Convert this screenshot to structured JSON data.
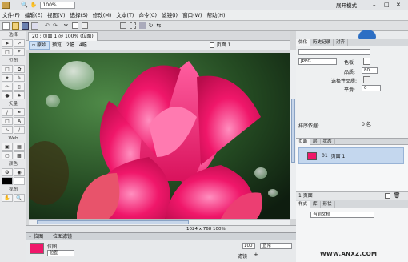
{
  "titlebar": {
    "zoom": "100%",
    "workspace": "展开模式"
  },
  "menu": [
    "文件(F)",
    "编辑(E)",
    "视图(V)",
    "选择(S)",
    "修改(M)",
    "文本(T)",
    "命令(C)",
    "滤镜(I)",
    "窗口(W)",
    "帮助(H)"
  ],
  "tools": {
    "select": "选择",
    "bitmap": "位图",
    "vector": "矢量",
    "web": "Web",
    "colors": "颜色",
    "view": "视图"
  },
  "document": {
    "tab": "20 : 页面 1 @ 100% (位图)",
    "views": [
      "原始",
      "预览",
      "2幅",
      "4幅"
    ],
    "page_label": "页面 1",
    "status": "1024 x 768   100%"
  },
  "properties": {
    "header_left": "位图",
    "header_right": "位图滤镜",
    "type": "位图",
    "name": "位图",
    "opacity": "100",
    "blend": "正常",
    "filter_label": "滤镜"
  },
  "right_panel": {
    "tabs": [
      "优化",
      "历史记录",
      "对齐"
    ],
    "format": "JPEG",
    "matte_label": "色板",
    "quality_label": "品质:",
    "quality": "80",
    "selective_label": "选择性品质:",
    "smoothing_label": "平滑:",
    "smoothing": "0",
    "sort_label": "排序依据:",
    "colors": "0 色"
  },
  "pages_panel": {
    "tabs": [
      "页面",
      "层",
      "状态"
    ],
    "page_num": "01",
    "page_name": "页面 1",
    "footer": "1 页面"
  },
  "styles_panel": {
    "tabs": [
      "样式",
      "库",
      "形状"
    ],
    "dropdown": "当前文档"
  },
  "watermark": "WWW.ANXZ.COM",
  "colors": {
    "accent": "#3a7bd5",
    "flower": "#f0176a",
    "leaf": "#2d6a2a"
  }
}
